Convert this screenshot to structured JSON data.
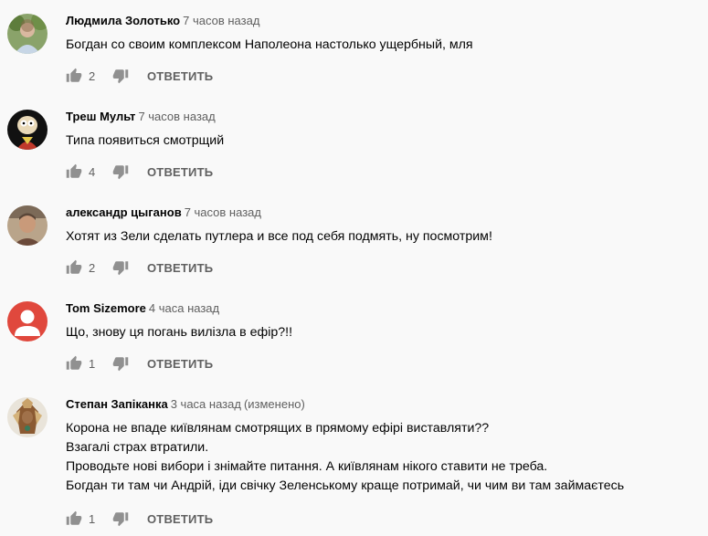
{
  "reply_label": "ОТВЕТИТЬ",
  "comments": [
    {
      "author": "Людмила Золотько",
      "time": "7 часов назад",
      "lines": [
        "Богдан со своим комплексом Наполеона настолько ущербный, мля"
      ],
      "likes": "2"
    },
    {
      "author": "Треш Мульт",
      "time": "7 часов назад",
      "lines": [
        "Типа появиться смотрщий"
      ],
      "likes": "4"
    },
    {
      "author": "александр цыганов",
      "time": "7 часов назад",
      "lines": [
        "Хотят из Зели сделать путлера и все под себя подмять, ну посмотрим!"
      ],
      "likes": "2"
    },
    {
      "author": "Tom Sizemore",
      "time": "4 часа назад",
      "lines": [
        "Що, знову ця погань вилізла в ефір?!!"
      ],
      "likes": "1"
    },
    {
      "author": "Степан Запіканка",
      "time": "3 часа назад",
      "edited": "(изменено)",
      "lines": [
        "Корона не впаде київлянам смотрящих в прямому ефірі виставляти??",
        "Взагалі страх втратили.",
        "Проводьте нові вибори і знімайте питання. А київлянам нікого ставити не треба.",
        "Богдан ти там чи Андрій, іди свічку Зеленському краще потримай, чи чим ви там займаєтесь"
      ],
      "likes": "1"
    }
  ]
}
